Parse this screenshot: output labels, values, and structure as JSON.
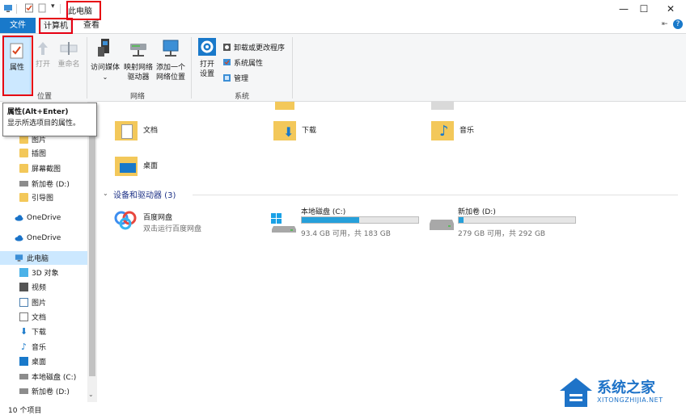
{
  "window": {
    "title": "此电脑",
    "minimize": "—",
    "maximize": "☐",
    "close": "✕"
  },
  "ribbon_tabs": {
    "file": "文件",
    "computer": "计算机",
    "view": "查看",
    "help_glyph": "?",
    "pin_glyph": "⇤",
    "expand_glyph": "⌄"
  },
  "ribbon": {
    "location_group": {
      "label": "位置",
      "properties": "属性",
      "open": "打开",
      "rename": "重命名"
    },
    "network_group": {
      "label": "网络",
      "access_media": "访问媒体",
      "map_drive_line1": "映射网络",
      "map_drive_line2": "驱动器",
      "add_location_line1": "添加一个",
      "add_location_line2": "网络位置"
    },
    "system_group": {
      "label": "系统",
      "open_settings_line1": "打开",
      "open_settings_line2": "设置",
      "uninstall": "卸载或更改程序",
      "system_properties": "系统属性",
      "manage": "管理"
    }
  },
  "tooltip": {
    "title": "属性(Alt+Enter)",
    "body": "显示所选项目的属性。"
  },
  "nav": {
    "items": [
      {
        "label": "图片"
      },
      {
        "label": "插图"
      },
      {
        "label": "屏幕截图"
      },
      {
        "label": "新加卷 (D:)"
      },
      {
        "label": "引导图"
      },
      {
        "label": "OneDrive"
      },
      {
        "label": "OneDrive"
      },
      {
        "label": "此电脑"
      },
      {
        "label": "3D 对象"
      },
      {
        "label": "视频"
      },
      {
        "label": "图片"
      },
      {
        "label": "文档"
      },
      {
        "label": "下载"
      },
      {
        "label": "音乐"
      },
      {
        "label": "桌面"
      },
      {
        "label": "本地磁盘 (C:)"
      },
      {
        "label": "新加卷 (D:)"
      }
    ]
  },
  "folders": {
    "documents": "文档",
    "downloads": "下载",
    "music": "音乐",
    "desktop": "桌面"
  },
  "devices": {
    "header": "设备和驱动器 (3)",
    "baidu": {
      "name": "百度网盘",
      "sub": "双击运行百度网盘"
    },
    "c_drive": {
      "name": "本地磁盘 (C:)",
      "space": "93.4 GB 可用，共 183 GB",
      "used_fraction": 0.49
    },
    "d_drive": {
      "name": "新加卷 (D:)",
      "space": "279 GB 可用，共 292 GB",
      "used_fraction": 0.045
    }
  },
  "status": {
    "count": "10 个项目"
  },
  "watermark": {
    "name": "系统之家",
    "url": "XITONGZHIJIA.NET"
  },
  "colors": {
    "file_tab": "#1979ca",
    "drive_fill": "#26a0da",
    "selection": "#cce8ff",
    "annotation_red": "#e60012"
  }
}
